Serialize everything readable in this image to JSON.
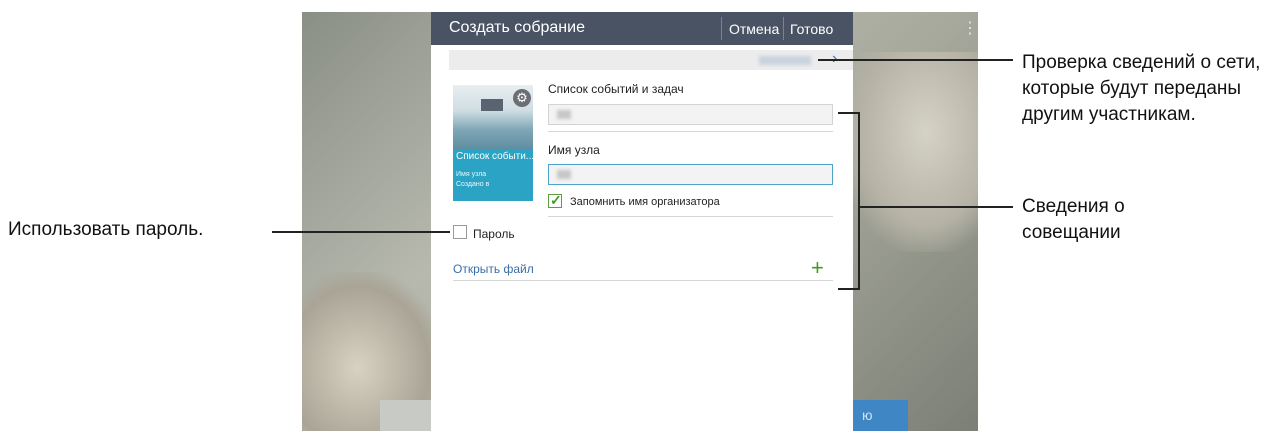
{
  "dialog": {
    "title": "Создать собрание",
    "cancel_label": "Отмена",
    "done_label": "Готово"
  },
  "thumbnail": {
    "title": "Список событи...",
    "line1": "Имя узла",
    "line2": "Создано в"
  },
  "form": {
    "events_label": "Список событий и задач",
    "host_label": "Имя узла",
    "remember_label": "Запомнить имя организатора",
    "remember_checked": true,
    "password_label": "Пароль",
    "password_checked": false,
    "open_file_label": "Открыть файл"
  },
  "background": {
    "right_button_text": "ю"
  },
  "callouts": {
    "network": "Проверка сведений о сети, которые будут переданы другим участникам.",
    "meeting": "Сведения о совещании",
    "password": "Использовать пароль."
  },
  "colors": {
    "titlebar": "#4a5363",
    "accent_blue": "#2aa3c4",
    "check_green": "#3f9b2b"
  }
}
